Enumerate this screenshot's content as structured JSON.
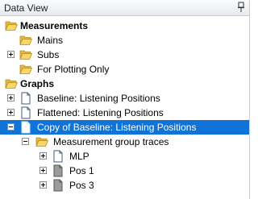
{
  "panel": {
    "title": "Data View"
  },
  "tree": {
    "measurements": {
      "label": "Measurements",
      "children": [
        "Mains",
        "Subs",
        "For Plotting Only"
      ]
    },
    "graphs": {
      "label": "Graphs",
      "children": [
        "Baseline: Listening Positions",
        "Flattened: Listening Positions",
        "Copy of Baseline: Listening Positions"
      ],
      "group": {
        "label": "Measurement group traces",
        "traces": [
          "MLP",
          "Pos 1",
          "Pos 3"
        ]
      }
    }
  },
  "colors": {
    "selection": "#0f73d8",
    "folder": "#f3c84e"
  }
}
